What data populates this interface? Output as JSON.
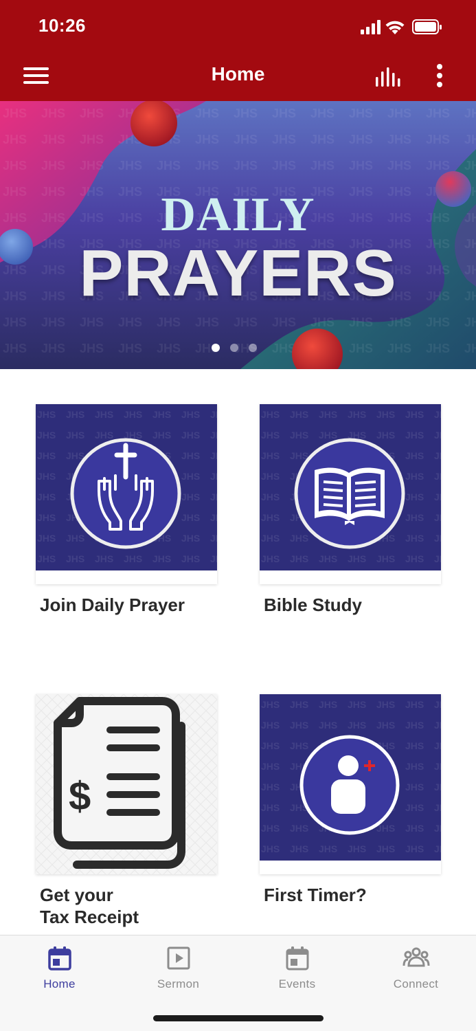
{
  "status_bar": {
    "time": "10:26"
  },
  "header": {
    "title": "Home",
    "menu_icon": "hamburger-menu-icon",
    "equalizer_icon": "equalizer-icon",
    "more_icon": "more-vertical-icon"
  },
  "banner": {
    "line1": "DAILY",
    "line2": "PRAYERS",
    "watermark": "JHS",
    "slide_count": 3,
    "active_slide": 1
  },
  "cards": [
    {
      "label": "Join Daily Prayer",
      "icon": "praying-hands-cross-icon"
    },
    {
      "label": "Bible Study",
      "icon": "open-bible-icon"
    },
    {
      "label": "Get your\nTax Receipt",
      "icon": "tax-receipt-document-icon"
    },
    {
      "label": "First Timer?",
      "icon": "add-person-icon"
    }
  ],
  "bottom_nav": {
    "items": [
      {
        "label": "Home",
        "icon": "calendar-icon",
        "active": true
      },
      {
        "label": "Sermon",
        "icon": "play-video-icon",
        "active": false
      },
      {
        "label": "Events",
        "icon": "calendar-icon",
        "active": false
      },
      {
        "label": "Connect",
        "icon": "group-people-icon",
        "active": false
      }
    ]
  },
  "colors": {
    "header_red": "#a30a10",
    "card_navy": "#2e2d7a",
    "icon_circle": "#3a389e",
    "nav_active": "#3d3d9e",
    "nav_inactive": "#8c8c8c"
  }
}
